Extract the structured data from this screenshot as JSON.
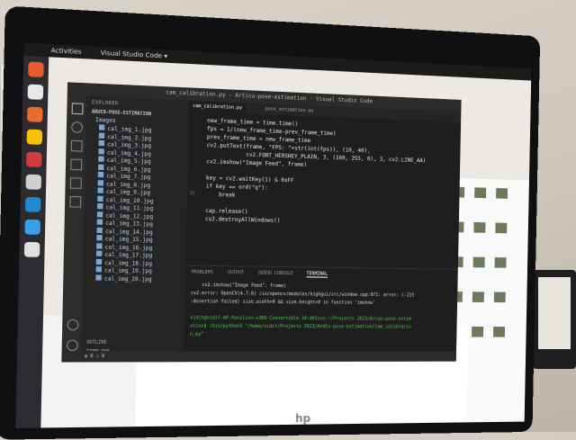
{
  "desktop": {
    "activities": "Activities",
    "app_menu": "Visual Studio Code ▾",
    "clock": "",
    "tray": ""
  },
  "vscode": {
    "window_title": "cam_calibration.py - Articu-pose-estimation - Visual Studio Code",
    "explorer_title": "EXPLORER",
    "folder_name": "ARUCO-POSE-ESTIMATION",
    "subfolder": "Images",
    "files": [
      "cal_img_1.jpg",
      "cal_img_2.jpg",
      "cal_img_3.jpg",
      "cal_img_4.jpg",
      "cal_img_5.jpg",
      "cal_img_6.jpg",
      "cal_img_7.jpg",
      "cal_img_8.jpg",
      "cal_img_9.jpg",
      "cal_img_10.jpg",
      "cal_img_11.jpg",
      "cal_img_12.jpg",
      "cal_img_13.jpg",
      "cal_img_14.jpg",
      "cal_img_15.jpg",
      "cal_img_16.jpg",
      "cal_img_17.jpg",
      "cal_img_18.jpg",
      "cal_img_19.jpg",
      "cal_img_20.jpg"
    ],
    "outline_label": "OUTLINE",
    "timeline_label": "TIMELINE",
    "tabs": [
      "cam_calibration.py",
      "pose_estimation.py"
    ],
    "code_lines": [
      {
        "no": "",
        "text": "new_frame_time = time.time()"
      },
      {
        "no": "",
        "text": "fps = 1/(new_frame_time-prev_frame_time)"
      },
      {
        "no": "",
        "text": "prev_frame_time = new_frame_time"
      },
      {
        "no": "",
        "text": "cv2.putText(frame, \"FPS: \"+str(int(fps)), (10, 40),"
      },
      {
        "no": "",
        "text": "            cv2.FONT_HERSHEY_PLAIN, 3, (100, 255, 0), 3, cv2.LINE_AA)"
      },
      {
        "no": "",
        "text": "cv2.imshow(\"Image Feed\", frame)"
      },
      {
        "no": "",
        "text": ""
      },
      {
        "no": "",
        "text": "key = cv2.waitKey(1) & 0xFF"
      },
      {
        "no": "",
        "text": "if key == ord(\"q\"):"
      },
      {
        "no": "35",
        "text": "    break"
      },
      {
        "no": "",
        "text": ""
      },
      {
        "no": "",
        "text": "cap.release()"
      },
      {
        "no": "",
        "text": "cv2.destroyAllWindows()"
      }
    ],
    "panel_tabs": [
      "PROBLEMS",
      "OUTPUT",
      "DEBUG CONSOLE",
      "TERMINAL"
    ],
    "terminal_lines": [
      {
        "text": "    cv2.imshow(\"Image Feed\", frame)",
        "prompt": false
      },
      {
        "text": "cv2.error: OpenCV(4.7.0) /io/opencv/modules/highgui/src/window.cpp:971: error: (-215",
        "prompt": false
      },
      {
        "text": ":Assertion failed) size.width>0 && size.height>0 in function 'imshow'",
        "prompt": false
      },
      {
        "text": "",
        "prompt": false
      },
      {
        "text": "vidit@vidit-HP-Pavilion-x360-Convertible-14-dh1xxx:~/Projects 2023/Arcuo-pose-estim",
        "prompt": true
      },
      {
        "text": "ation$ /bin/python3 \"/home/vidit/Projects 2023/ArUCo-pose-estimation/cam_calibratio",
        "prompt": true
      },
      {
        "text": "n.py\"",
        "prompt": true
      }
    ],
    "status_text": "⊗ 0 ⚠ 0"
  },
  "colors": {
    "vscode_bg": "#1e1e1e",
    "explorer_bg": "#252526",
    "terminal_prompt": "#4fd14f",
    "dock_bg": "#2c2b30"
  }
}
